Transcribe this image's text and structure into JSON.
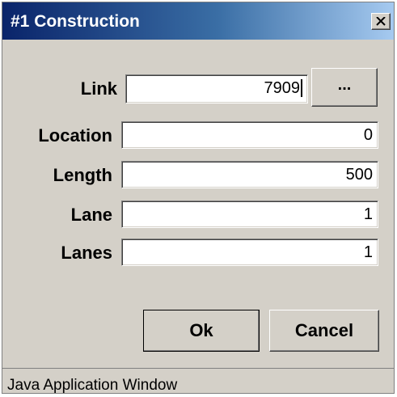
{
  "window": {
    "title": "#1 Construction",
    "close_label": "X"
  },
  "form": {
    "link": {
      "label": "Link",
      "value": "7909",
      "browse_label": "..."
    },
    "fields": [
      {
        "label": "Location",
        "value": "0"
      },
      {
        "label": "Length",
        "value": "500"
      },
      {
        "label": "Lane",
        "value": "1"
      },
      {
        "label": "Lanes",
        "value": "1"
      }
    ]
  },
  "buttons": {
    "ok_label": "Ok",
    "cancel_label": "Cancel"
  },
  "status": {
    "text": "Java Application Window"
  },
  "colors": {
    "titlebar_start": "#0a246a",
    "titlebar_end": "#a6caf0",
    "face": "#d4d0c8"
  }
}
